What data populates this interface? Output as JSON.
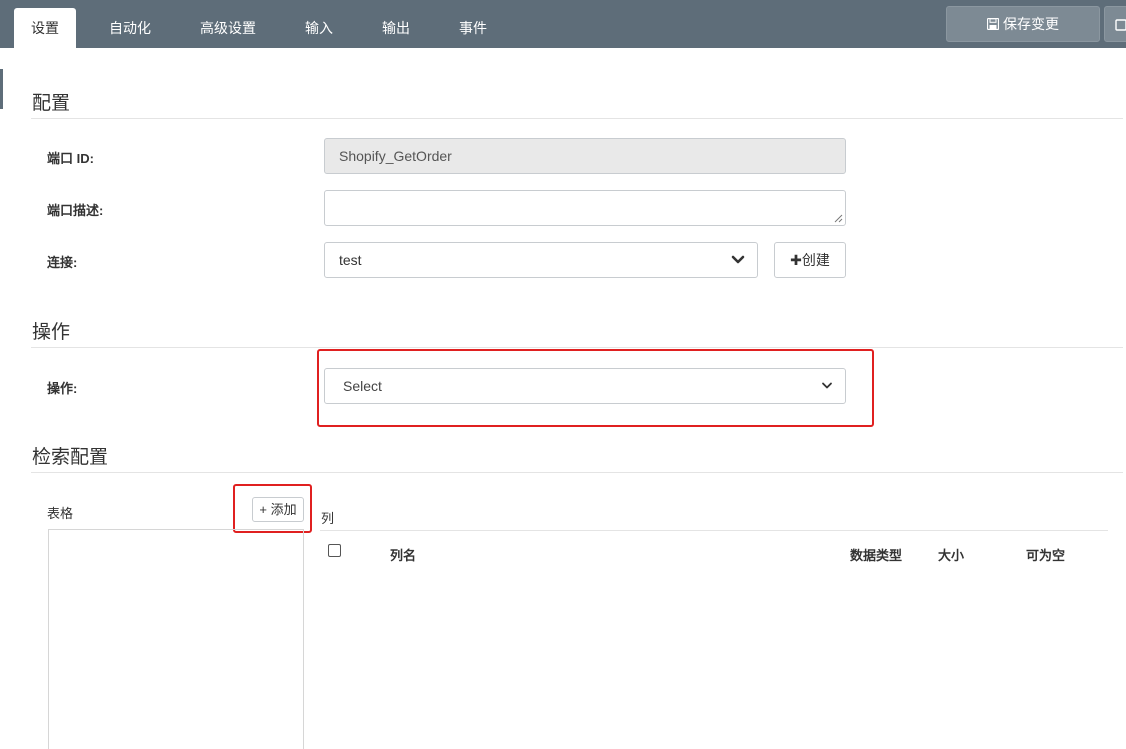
{
  "tabs": [
    {
      "label": "设置",
      "active": true
    },
    {
      "label": "自动化",
      "active": false
    },
    {
      "label": "高级设置",
      "active": false
    },
    {
      "label": "输入",
      "active": false
    },
    {
      "label": "输出",
      "active": false
    },
    {
      "label": "事件",
      "active": false
    }
  ],
  "toolbar": {
    "save_label": "保存变更"
  },
  "config": {
    "title": "配置",
    "port_id_label": "端口 ID:",
    "port_id_value": "Shopify_GetOrder",
    "port_desc_label": "端口描述:",
    "port_desc_value": "",
    "connection_label": "连接:",
    "connection_value": "test",
    "create_label": "创建"
  },
  "operation": {
    "title": "操作",
    "label": "操作:",
    "value": "Select"
  },
  "retrieval": {
    "title": "检索配置",
    "tables_label": "表格",
    "add_label": "+ 添加",
    "columns_label": "列",
    "column_headers": [
      "列名",
      "数据类型",
      "大小",
      "可为空"
    ]
  },
  "colors": {
    "topbar": "#5e6d79",
    "highlight": "#e02020"
  }
}
